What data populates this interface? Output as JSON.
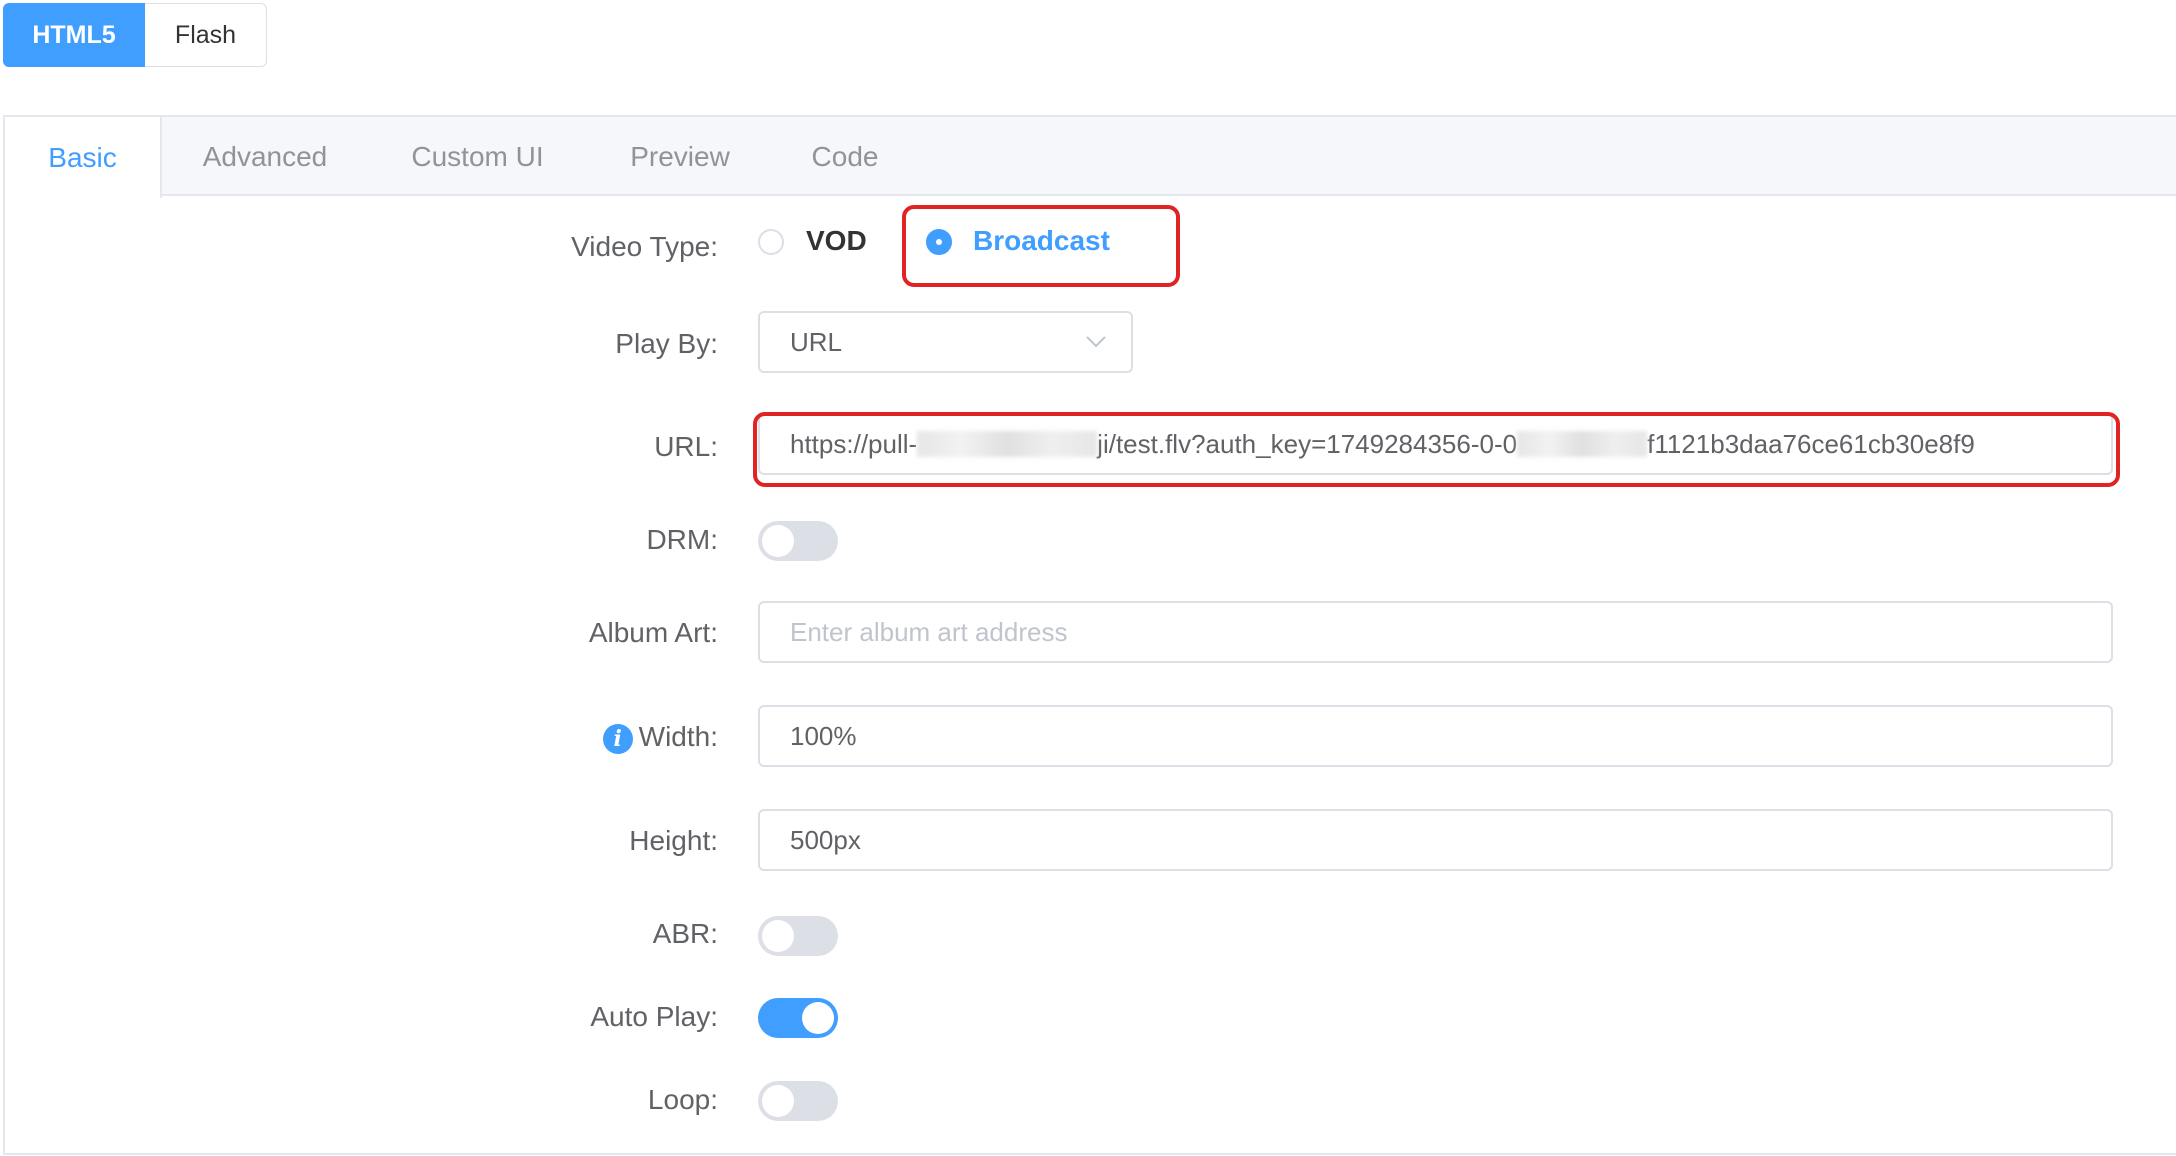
{
  "mode_switch": {
    "options": [
      "HTML5",
      "Flash"
    ],
    "selected": "HTML5"
  },
  "tabs": [
    {
      "label": "Basic",
      "active": true
    },
    {
      "label": "Advanced",
      "active": false
    },
    {
      "label": "Custom UI",
      "active": false
    },
    {
      "label": "Preview",
      "active": false
    },
    {
      "label": "Code",
      "active": false
    }
  ],
  "form": {
    "video_type": {
      "label": "Video Type:",
      "options": [
        "VOD",
        "Broadcast"
      ],
      "selected": "Broadcast"
    },
    "play_by": {
      "label": "Play By:",
      "value": "URL"
    },
    "url": {
      "label": "URL:",
      "value_parts": [
        "https://pull-",
        "ji/test.flv?auth_key=1749284356-0-0",
        "f1121b3daa76ce61cb30e8f9"
      ]
    },
    "drm": {
      "label": "DRM:",
      "on": false
    },
    "album_art": {
      "label": "Album Art:",
      "value": "",
      "placeholder": "Enter album art address"
    },
    "width": {
      "label": "Width:",
      "value": "100%"
    },
    "height": {
      "label": "Height:",
      "value": "500px"
    },
    "abr": {
      "label": "ABR:",
      "on": false
    },
    "auto_play": {
      "label": "Auto Play:",
      "on": true
    },
    "loop": {
      "label": "Loop:",
      "on": false
    }
  },
  "colors": {
    "accent": "#409eff",
    "highlight": "#e02424",
    "label": "#606266",
    "border": "#dcdfe6"
  }
}
